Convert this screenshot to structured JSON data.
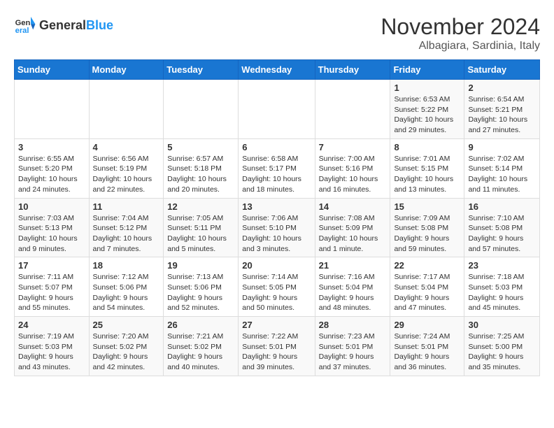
{
  "logo": {
    "general": "General",
    "blue": "Blue"
  },
  "title": "November 2024",
  "subtitle": "Albagiara, Sardinia, Italy",
  "days_of_week": [
    "Sunday",
    "Monday",
    "Tuesday",
    "Wednesday",
    "Thursday",
    "Friday",
    "Saturday"
  ],
  "weeks": [
    [
      {
        "day": "",
        "info": ""
      },
      {
        "day": "",
        "info": ""
      },
      {
        "day": "",
        "info": ""
      },
      {
        "day": "",
        "info": ""
      },
      {
        "day": "",
        "info": ""
      },
      {
        "day": "1",
        "info": "Sunrise: 6:53 AM\nSunset: 5:22 PM\nDaylight: 10 hours and 29 minutes."
      },
      {
        "day": "2",
        "info": "Sunrise: 6:54 AM\nSunset: 5:21 PM\nDaylight: 10 hours and 27 minutes."
      }
    ],
    [
      {
        "day": "3",
        "info": "Sunrise: 6:55 AM\nSunset: 5:20 PM\nDaylight: 10 hours and 24 minutes."
      },
      {
        "day": "4",
        "info": "Sunrise: 6:56 AM\nSunset: 5:19 PM\nDaylight: 10 hours and 22 minutes."
      },
      {
        "day": "5",
        "info": "Sunrise: 6:57 AM\nSunset: 5:18 PM\nDaylight: 10 hours and 20 minutes."
      },
      {
        "day": "6",
        "info": "Sunrise: 6:58 AM\nSunset: 5:17 PM\nDaylight: 10 hours and 18 minutes."
      },
      {
        "day": "7",
        "info": "Sunrise: 7:00 AM\nSunset: 5:16 PM\nDaylight: 10 hours and 16 minutes."
      },
      {
        "day": "8",
        "info": "Sunrise: 7:01 AM\nSunset: 5:15 PM\nDaylight: 10 hours and 13 minutes."
      },
      {
        "day": "9",
        "info": "Sunrise: 7:02 AM\nSunset: 5:14 PM\nDaylight: 10 hours and 11 minutes."
      }
    ],
    [
      {
        "day": "10",
        "info": "Sunrise: 7:03 AM\nSunset: 5:13 PM\nDaylight: 10 hours and 9 minutes."
      },
      {
        "day": "11",
        "info": "Sunrise: 7:04 AM\nSunset: 5:12 PM\nDaylight: 10 hours and 7 minutes."
      },
      {
        "day": "12",
        "info": "Sunrise: 7:05 AM\nSunset: 5:11 PM\nDaylight: 10 hours and 5 minutes."
      },
      {
        "day": "13",
        "info": "Sunrise: 7:06 AM\nSunset: 5:10 PM\nDaylight: 10 hours and 3 minutes."
      },
      {
        "day": "14",
        "info": "Sunrise: 7:08 AM\nSunset: 5:09 PM\nDaylight: 10 hours and 1 minute."
      },
      {
        "day": "15",
        "info": "Sunrise: 7:09 AM\nSunset: 5:08 PM\nDaylight: 9 hours and 59 minutes."
      },
      {
        "day": "16",
        "info": "Sunrise: 7:10 AM\nSunset: 5:08 PM\nDaylight: 9 hours and 57 minutes."
      }
    ],
    [
      {
        "day": "17",
        "info": "Sunrise: 7:11 AM\nSunset: 5:07 PM\nDaylight: 9 hours and 55 minutes."
      },
      {
        "day": "18",
        "info": "Sunrise: 7:12 AM\nSunset: 5:06 PM\nDaylight: 9 hours and 54 minutes."
      },
      {
        "day": "19",
        "info": "Sunrise: 7:13 AM\nSunset: 5:06 PM\nDaylight: 9 hours and 52 minutes."
      },
      {
        "day": "20",
        "info": "Sunrise: 7:14 AM\nSunset: 5:05 PM\nDaylight: 9 hours and 50 minutes."
      },
      {
        "day": "21",
        "info": "Sunrise: 7:16 AM\nSunset: 5:04 PM\nDaylight: 9 hours and 48 minutes."
      },
      {
        "day": "22",
        "info": "Sunrise: 7:17 AM\nSunset: 5:04 PM\nDaylight: 9 hours and 47 minutes."
      },
      {
        "day": "23",
        "info": "Sunrise: 7:18 AM\nSunset: 5:03 PM\nDaylight: 9 hours and 45 minutes."
      }
    ],
    [
      {
        "day": "24",
        "info": "Sunrise: 7:19 AM\nSunset: 5:03 PM\nDaylight: 9 hours and 43 minutes."
      },
      {
        "day": "25",
        "info": "Sunrise: 7:20 AM\nSunset: 5:02 PM\nDaylight: 9 hours and 42 minutes."
      },
      {
        "day": "26",
        "info": "Sunrise: 7:21 AM\nSunset: 5:02 PM\nDaylight: 9 hours and 40 minutes."
      },
      {
        "day": "27",
        "info": "Sunrise: 7:22 AM\nSunset: 5:01 PM\nDaylight: 9 hours and 39 minutes."
      },
      {
        "day": "28",
        "info": "Sunrise: 7:23 AM\nSunset: 5:01 PM\nDaylight: 9 hours and 37 minutes."
      },
      {
        "day": "29",
        "info": "Sunrise: 7:24 AM\nSunset: 5:01 PM\nDaylight: 9 hours and 36 minutes."
      },
      {
        "day": "30",
        "info": "Sunrise: 7:25 AM\nSunset: 5:00 PM\nDaylight: 9 hours and 35 minutes."
      }
    ]
  ]
}
